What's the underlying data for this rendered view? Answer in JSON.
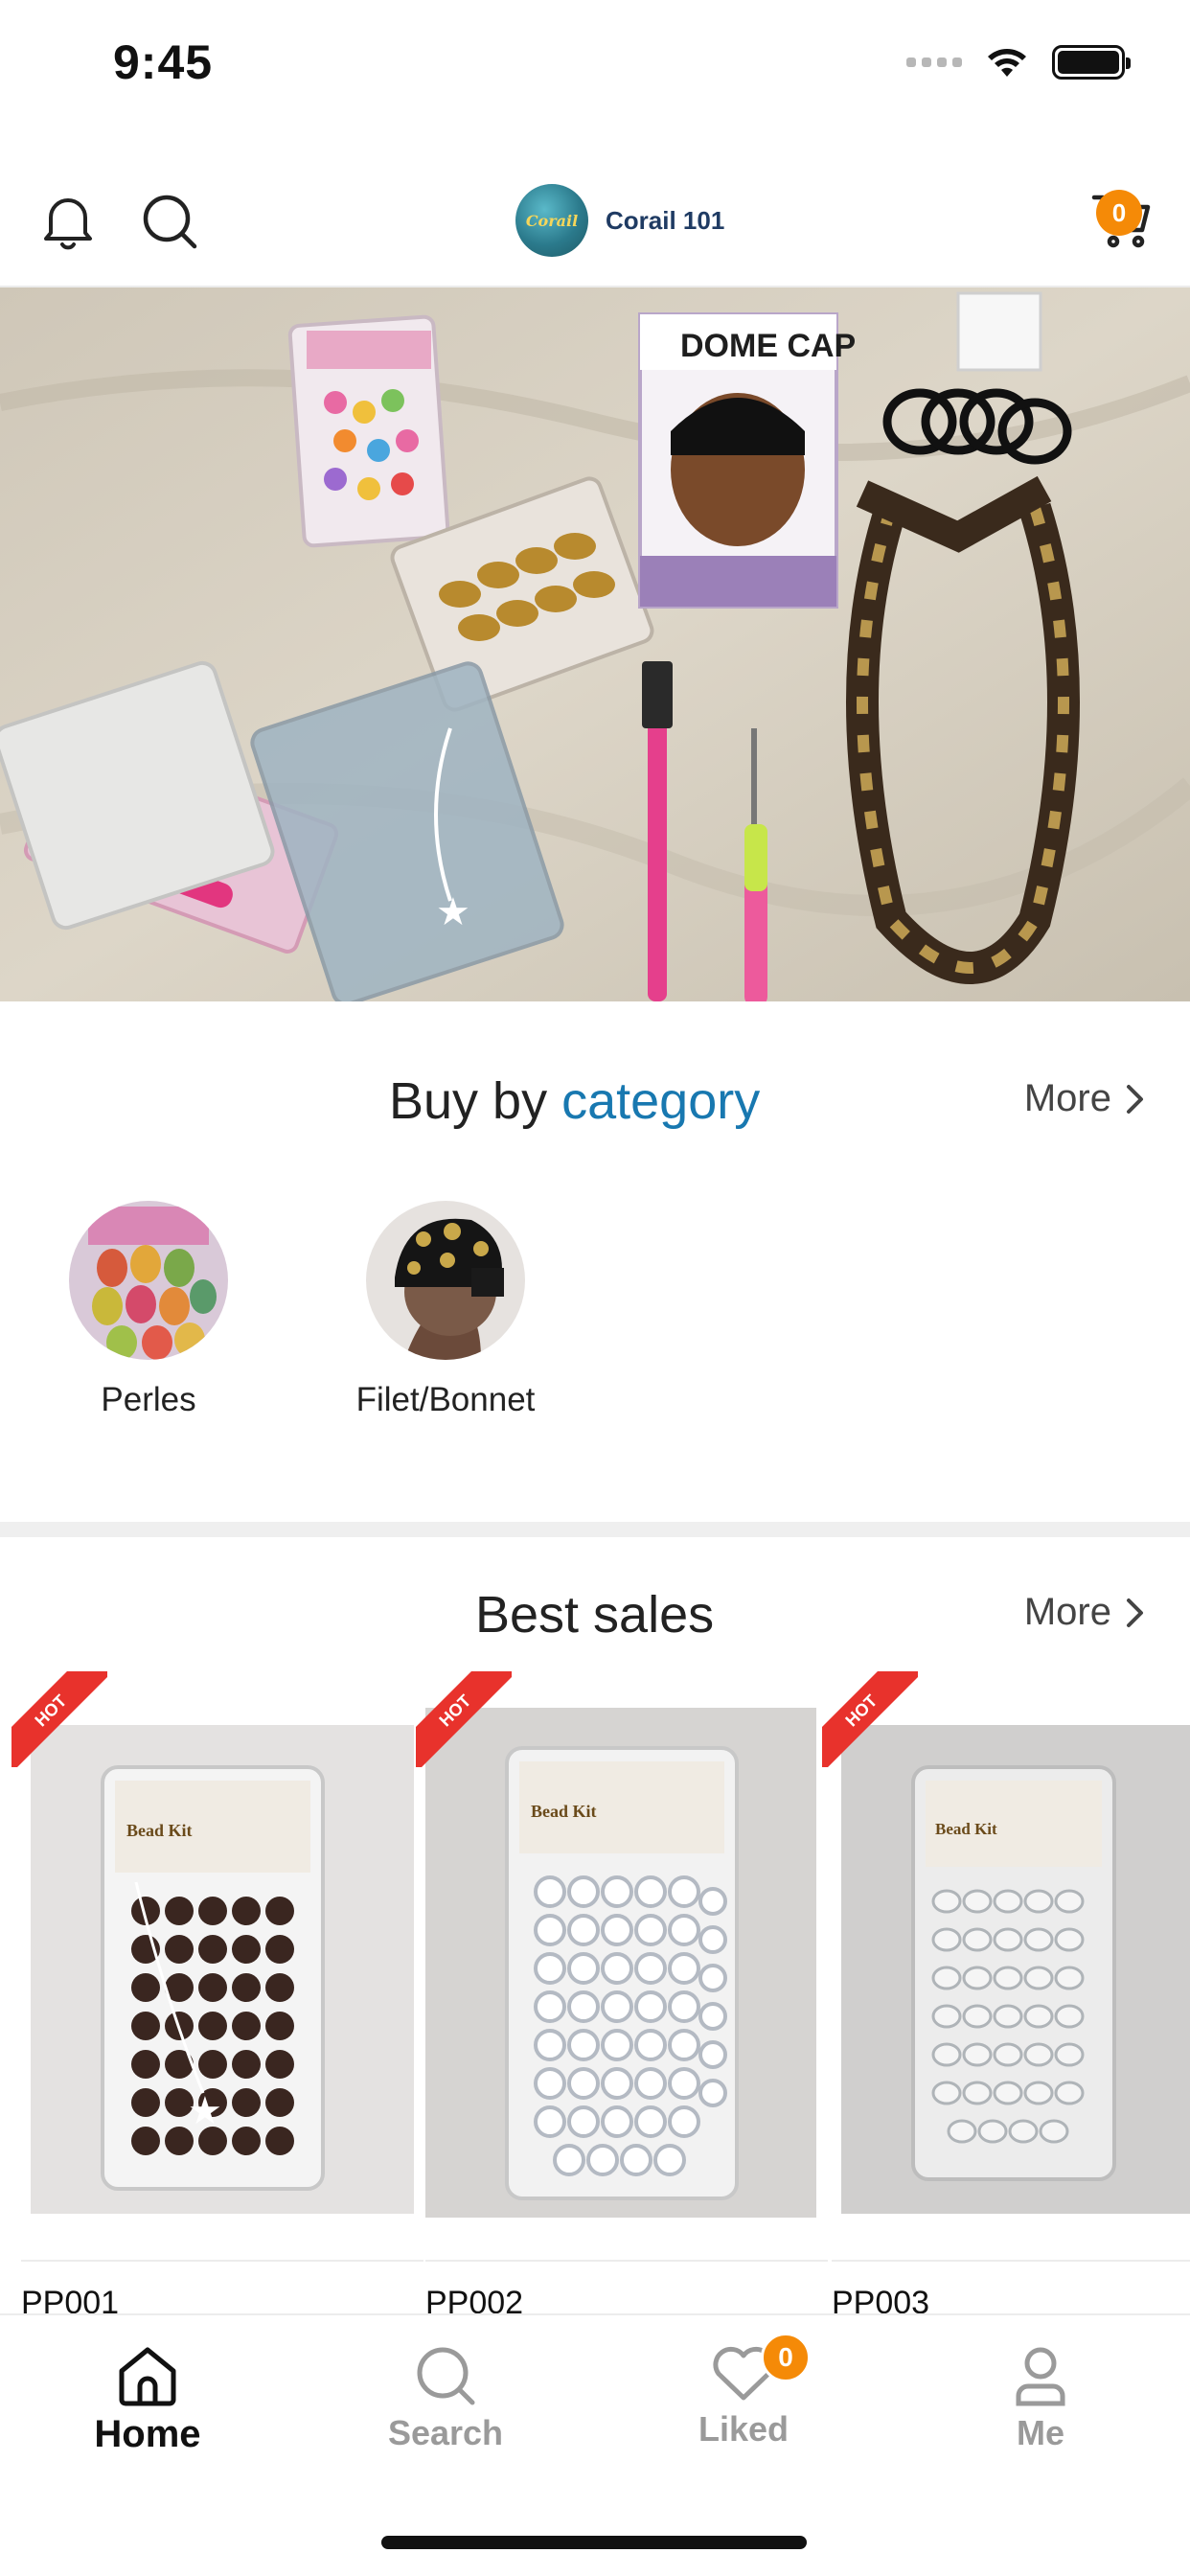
{
  "status_bar": {
    "time": "9:45"
  },
  "header": {
    "brand_name": "Corail 101",
    "brand_logo_text": "Corail",
    "cart_count": "0",
    "icons": [
      "bell-icon",
      "search-icon",
      "cart-icon"
    ]
  },
  "hero": {
    "dome_cap_text": "DOME CAP"
  },
  "categories": {
    "title_plain": "Buy by",
    "title_accent": "category",
    "more_label": "More",
    "items": [
      {
        "label": "Perles"
      },
      {
        "label": "Filet/Bonnet"
      }
    ]
  },
  "best_sales": {
    "title": "Best sales",
    "more_label": "More",
    "hot_label": "HOT",
    "products": [
      {
        "code": "PP001"
      },
      {
        "code": "PP002"
      },
      {
        "code": "PP003"
      }
    ]
  },
  "tab_bar": {
    "tabs": [
      {
        "label": "Home",
        "active": true
      },
      {
        "label": "Search",
        "active": false
      },
      {
        "label": "Liked",
        "active": false,
        "badge": "0"
      },
      {
        "label": "Me",
        "active": false
      }
    ]
  },
  "colors": {
    "accent": "#1878b0",
    "badge": "#f58a07",
    "hot": "#e8322c"
  }
}
